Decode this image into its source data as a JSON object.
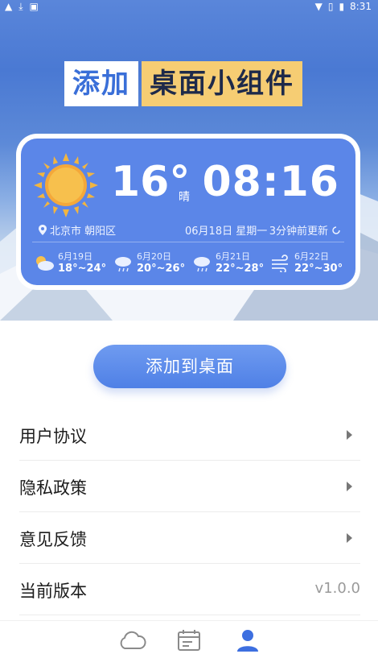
{
  "statusbar": {
    "left_icons": [
      "a-icon",
      "download-icon",
      "a-box-icon"
    ],
    "right_icons": [
      "wifi-icon",
      "sim-icon",
      "battery-icon"
    ],
    "time": "8:31"
  },
  "header": {
    "title_part1": "添加",
    "title_part2": "桌面小组件"
  },
  "widget": {
    "temperature": "16°",
    "condition": "晴",
    "clock": "08:16",
    "location": "北京市 朝阳区",
    "date": "06月18日 星期一",
    "updated": "3分钟前更新",
    "forecast": [
      {
        "date": "6月19日",
        "range": "18°~24°",
        "icon": "partly-cloudy-icon"
      },
      {
        "date": "6月20日",
        "range": "20°~26°",
        "icon": "cloud-rain-icon"
      },
      {
        "date": "6月21日",
        "range": "22°~28°",
        "icon": "cloud-rain-icon"
      },
      {
        "date": "6月22日",
        "range": "22°~30°",
        "icon": "wind-icon"
      }
    ]
  },
  "add_button": "添加到桌面",
  "menu": {
    "items": [
      {
        "label": "用户协议"
      },
      {
        "label": "隐私政策"
      },
      {
        "label": "意见反馈"
      },
      {
        "label": "当前版本",
        "value": "v1.0.0"
      }
    ]
  },
  "tabbar": {
    "tabs": [
      "cloud-icon",
      "calendar-icon",
      "user-icon"
    ],
    "active_color": "#3d6fe0",
    "inactive_color": "#8a8a8a"
  },
  "colors": {
    "accent": "#5b86e8",
    "title_highlight": "#f6cd73"
  }
}
